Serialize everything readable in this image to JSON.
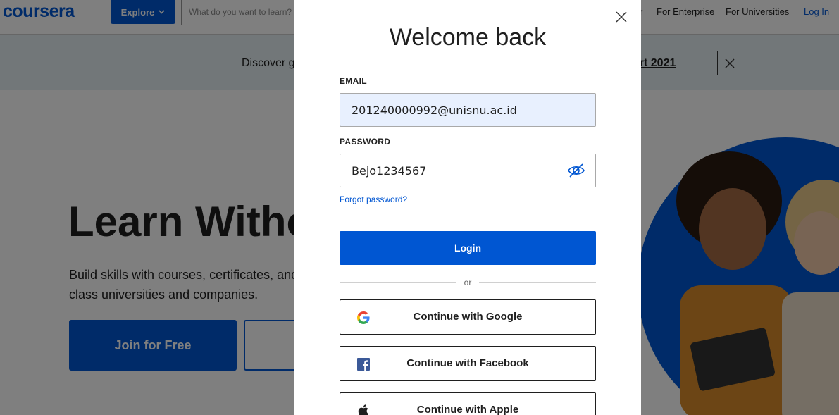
{
  "background": {
    "logo": "coursera",
    "explore_label": "Explore",
    "search_placeholder": "What do you want to learn?",
    "nav_items": [
      "r",
      "For Enterprise",
      "For Universities"
    ],
    "nav_login": "Log In",
    "banner_text": "Discover g",
    "banner_link": "ort 2021",
    "hero_title": "Learn Witho",
    "hero_subtitle": "Build skills with courses, certificates, and class universities and companies.",
    "join_button": "Join for Free"
  },
  "modal": {
    "title": "Welcome back",
    "email_label": "EMAIL",
    "email_value": "201240000992@unisnu.ac.id",
    "password_label": "PASSWORD",
    "password_value": "Bejo1234567",
    "forgot_password": "Forgot password?",
    "login_button": "Login",
    "divider_text": "or",
    "google_button": "Continue with Google",
    "facebook_button": "Continue with Facebook",
    "apple_button": "Continue with Apple"
  },
  "colors": {
    "brand_blue": "#0056d2",
    "autofill_bg": "#e8f0fe",
    "banner_bg": "#e4eff2"
  },
  "icons": [
    "close-icon",
    "eye-slash-icon",
    "google-icon",
    "facebook-icon",
    "apple-icon",
    "chevron-down-icon"
  ]
}
